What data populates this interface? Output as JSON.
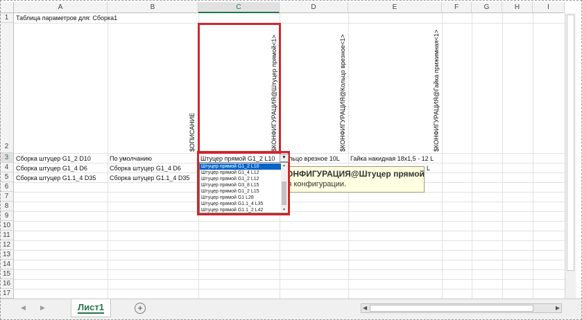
{
  "columns": [
    "A",
    "B",
    "C",
    "D",
    "E",
    "F",
    "G",
    "H",
    "I"
  ],
  "rows": [
    "1",
    "2",
    "3",
    "4",
    "5",
    "6",
    "7",
    "8",
    "9",
    "10",
    "11",
    "12",
    "13",
    "14",
    "15",
    "16",
    "17"
  ],
  "cells": {
    "a1": "Таблица параметров для: Сборка1",
    "a3": "Сборка штуцер G1_2 D10",
    "b3": "По умолчанию",
    "c3": "Штуцер прямой G1_2 L10",
    "d3": "Кольцо врезное 10L",
    "e3": "Гайка накидная 18х1,5 - 12 L",
    "a4": "Сборка штуцер G1_4 D6",
    "b4": "Сборка штуцер G1_4 D6",
    "e4": "L",
    "a5": "Сборка штуцер G1.1_4 D35",
    "b5": "Сборка штуцер G1.1_4 D35"
  },
  "headers": {
    "b2": "$ОПИСАНИЕ",
    "c2": "$КОНФИГУРАЦИЯ@Штуцер прямой<1>",
    "d2": "$КОНФИГУРАЦИЯ@Кольцо врезное<1>",
    "e2": "$КОНФИГУРАЦИЯ@Гайка прижимная<1>"
  },
  "dropdown": {
    "items": [
      "Штуцер прямой G1_2 L10",
      "Штуцер прямой G1_4 L12",
      "Штуцер прямой G1_2 L12",
      "Штуцер прямой G3_8 L15",
      "Штуцер прямой G1_2 L15",
      "Штуцер прямой G1 L28",
      "Штуцер прямой G1.1_4 L35",
      "Штуцер прямой G1.1_2 L42"
    ],
    "selected_index": 0,
    "arrow": "▼"
  },
  "tooltip": {
    "title": "$КОНФИГУРАЦИЯ@Штуцер прямой<1>",
    "text": "Имя конфигурации."
  },
  "sheet_tab": {
    "label": "Лист1",
    "add_icon": "⊕"
  },
  "icons": {
    "nav_prev": "◀",
    "nav_next": "▶",
    "scroll_left": "◀",
    "scroll_right": "▶",
    "scroll_up": "▲",
    "scroll_down": "▼",
    "add_sheet": "plus-circle-icon"
  },
  "colors": {
    "accent": "#217346",
    "highlight": "#d0262c",
    "selection": "#0a64c8",
    "tooltip_bg": "#ffffe1"
  }
}
